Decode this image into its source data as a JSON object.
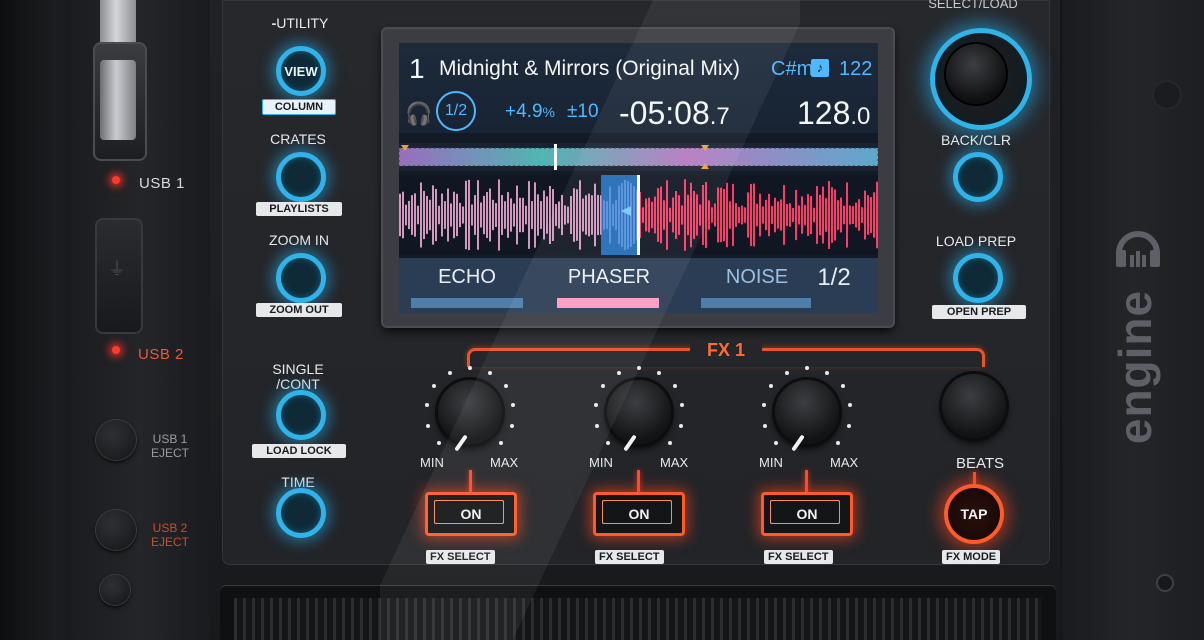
{
  "usb": {
    "usb1_label": "USB 1",
    "usb2_label": "USB 2",
    "usb1_eject_line1": "USB 1",
    "usb1_eject_line2": "EJECT",
    "usb2_eject_line1": "USB 2",
    "usb2_eject_line2": "EJECT"
  },
  "left_buttons": {
    "utility": "UTILITY",
    "view": "VIEW",
    "column": "COLUMN",
    "crates": "CRATES",
    "playlists": "PLAYLISTS",
    "zoom_in": "ZOOM IN",
    "zoom_out": "ZOOM OUT",
    "single_line1": "SINGLE",
    "single_line2": "/CONT",
    "load_lock": "LOAD LOCK",
    "time": "TIME"
  },
  "screen": {
    "deck_number": "1",
    "track_title": "Midnight & Mirrors (Original Mix)",
    "key": "C#m",
    "key_bpm": "122",
    "loop": "1/2",
    "pitch": "+4.9",
    "pitch_unit": "%",
    "pitch_range": "±10",
    "time_remaining_main": "-05:08",
    "time_remaining_dec": ".7",
    "bpm_main": "128",
    "bpm_dec": ".0",
    "fx_tabs": [
      "ECHO",
      "PHASER",
      "NOISE"
    ],
    "fx_page": "1/2"
  },
  "fx": {
    "title": "FX 1",
    "min_label": "MIN",
    "max_label": "MAX",
    "on_label": "ON",
    "fx_select": "FX SELECT",
    "beats": "BEATS",
    "tap": "TAP",
    "fx_mode": "FX MODE"
  },
  "right_buttons": {
    "select_load": "SELECT/LOAD",
    "back_clr": "BACK/CLR",
    "load_prep": "LOAD PREP",
    "open_prep": "OPEN PREP"
  },
  "brand": "engine",
  "colors": {
    "accent_blue": "#2fb3e8",
    "accent_red": "#ff5a2a",
    "screen_highlight": "#4fb8ff"
  }
}
